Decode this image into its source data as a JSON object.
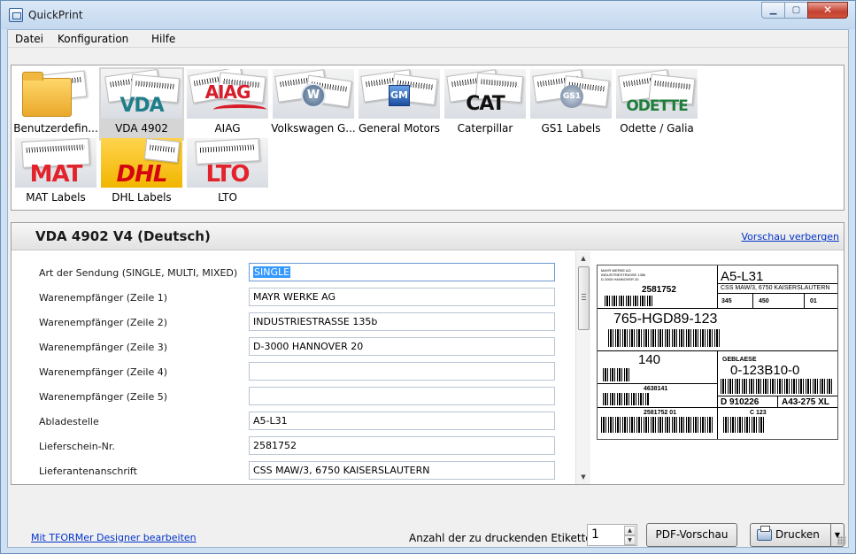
{
  "window": {
    "title": "QuickPrint"
  },
  "menu": [
    "Datei",
    "Konfiguration",
    "Hilfe"
  ],
  "gallery": {
    "selected_index": 1,
    "tiles": [
      {
        "label": "Benutzerdefin...",
        "brand": "",
        "icon": "folder-icon"
      },
      {
        "label": "VDA 4902",
        "brand": "VDA",
        "brand_color": "#1f7e8a"
      },
      {
        "label": "AIAG",
        "brand": "AIAG",
        "brand_color": "#d81c2a"
      },
      {
        "label": "Volkswagen G...",
        "brand": "",
        "icon": "vw-logo-icon"
      },
      {
        "label": "General Motors",
        "brand": "GM",
        "brand_color": "#1d4fa0"
      },
      {
        "label": "Caterpillar",
        "brand": "CAT",
        "brand_color": "#111111"
      },
      {
        "label": "GS1 Labels",
        "brand": "GS1",
        "brand_color": "#6a7f99"
      },
      {
        "label": "Odette / Galia",
        "brand": "ODETTE",
        "brand_color": "#1f7e3a"
      },
      {
        "label": "MAT Labels",
        "brand": "MAT",
        "brand_color": "#e3232c"
      },
      {
        "label": "DHL Labels",
        "brand": "DHL",
        "brand_color": "#d40511"
      },
      {
        "label": "LTO",
        "brand": "LTO",
        "brand_color": "#e3232c"
      }
    ]
  },
  "form": {
    "title": "VDA 4902 V4 (Deutsch)",
    "toggle_preview": "Vorschau verbergen",
    "fields": [
      {
        "label": "Art der Sendung (SINGLE, MULTI, MIXED)",
        "value": "SINGLE"
      },
      {
        "label": "Warenempfänger (Zeile 1)",
        "value": "MAYR WERKE AG"
      },
      {
        "label": "Warenempfänger (Zeile 2)",
        "value": "INDUSTRIESTRASSE 135b"
      },
      {
        "label": "Warenempfänger (Zeile 3)",
        "value": "D-3000 HANNOVER 20"
      },
      {
        "label": "Warenempfänger (Zeile 4)",
        "value": ""
      },
      {
        "label": "Warenempfänger (Zeile 5)",
        "value": ""
      },
      {
        "label": "Abladestelle",
        "value": "A5-L31"
      },
      {
        "label": "Lieferschein-Nr.",
        "value": "2581752"
      },
      {
        "label": "Lieferantenanschrift",
        "value": "CSS MAW/3, 6750 KAISERSLAUTERN"
      }
    ]
  },
  "preview_label": {
    "recipient": "MAYR WERKE AG",
    "recipient_street": "INDUSTRIESTRASSE 135b",
    "recipient_city": "D-3000 HANNOVER 20",
    "unloading_point": "A5-L31",
    "delivery_note": "2581752",
    "supplier_address": "CSS MAW/3, 6750 KAISERSLAUTERN",
    "weight_net": "345",
    "weight_gross": "450",
    "packages": "01",
    "part_number": "765-HGD89-123",
    "quantity": "140",
    "description": "GEBLAESE",
    "supplier_part": "0-123B10-0",
    "supplier_number": "4638141",
    "date": "D 910226",
    "change_level": "A43-275 XL",
    "package_id": "2581752 01",
    "batch": "C 123"
  },
  "bottom": {
    "designer_link": "Mit TFORMer Designer bearbeiten",
    "count_label": "Anzahl der zu druckenden Etiketten:",
    "count_value": "1",
    "pdf_preview": "PDF-Vorschau",
    "print": "Drucken"
  }
}
